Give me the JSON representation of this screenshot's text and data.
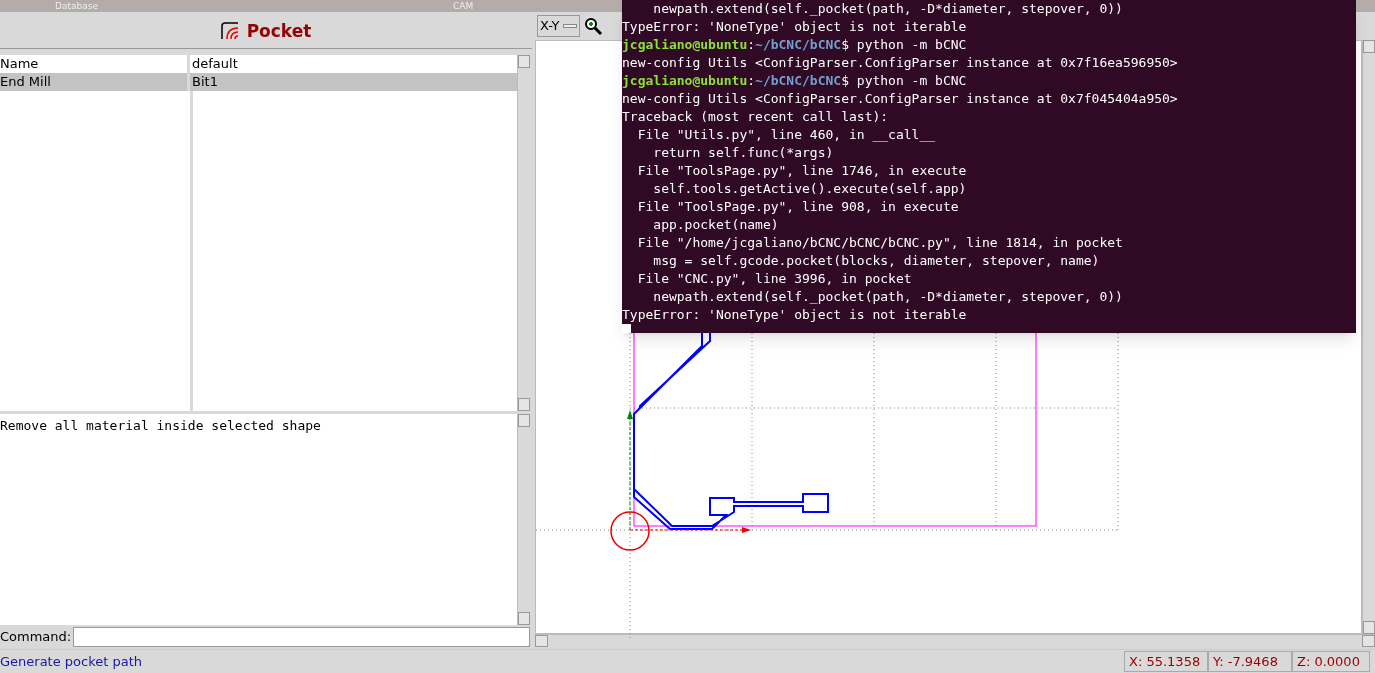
{
  "top_tabs": [
    "Database",
    "CAM"
  ],
  "panel": {
    "title": "Pocket",
    "properties": [
      {
        "name": "Name",
        "value": "default",
        "selected": false
      },
      {
        "name": "End Mill",
        "value": "Bit1",
        "selected": true
      }
    ],
    "description": "Remove all material inside selected shape",
    "command": {
      "label": "Command:"
    }
  },
  "canvas": {
    "view": "X-Y"
  },
  "terminal": [
    {
      "kind": "plain",
      "text": "    newpath.extend(self._pocket(path, -D*diameter, stepover, 0))"
    },
    {
      "kind": "plain",
      "text": "TypeError: 'NoneType' object is not iterable"
    },
    {
      "kind": "prompt",
      "user": "jcgaliano@ubuntu",
      "sep": ":",
      "path": "~/bCNC/bCNC",
      "text": "$ python -m bCNC"
    },
    {
      "kind": "plain",
      "text": "new-config Utils <ConfigParser.ConfigParser instance at 0x7f16ea596950>"
    },
    {
      "kind": "prompt",
      "user": "jcgaliano@ubuntu",
      "sep": ":",
      "path": "~/bCNC/bCNC",
      "text": "$ python -m bCNC"
    },
    {
      "kind": "plain",
      "text": "new-config Utils <ConfigParser.ConfigParser instance at 0x7f045404a950>"
    },
    {
      "kind": "plain",
      "text": "Traceback (most recent call last):"
    },
    {
      "kind": "plain",
      "text": "  File \"Utils.py\", line 460, in __call__"
    },
    {
      "kind": "plain",
      "text": "    return self.func(*args)"
    },
    {
      "kind": "plain",
      "text": "  File \"ToolsPage.py\", line 1746, in execute"
    },
    {
      "kind": "plain",
      "text": "    self.tools.getActive().execute(self.app)"
    },
    {
      "kind": "plain",
      "text": "  File \"ToolsPage.py\", line 908, in execute"
    },
    {
      "kind": "plain",
      "text": "    app.pocket(name)"
    },
    {
      "kind": "plain",
      "text": "  File \"/home/jcgaliano/bCNC/bCNC/bCNC.py\", line 1814, in pocket"
    },
    {
      "kind": "plain",
      "text": "    msg = self.gcode.pocket(blocks, diameter, stepover, name)"
    },
    {
      "kind": "plain",
      "text": "  File \"CNC.py\", line 3996, in pocket"
    },
    {
      "kind": "plain",
      "text": "    newpath.extend(self._pocket(path, -D*diameter, stepover, 0))"
    },
    {
      "kind": "plain",
      "text": "TypeError: 'NoneType' object is not iterable"
    }
  ],
  "status_bar": {
    "message": "Generate pocket path",
    "x": "X: 55.1358",
    "y": "Y: -7.9468",
    "z": "Z: 0.0000"
  }
}
